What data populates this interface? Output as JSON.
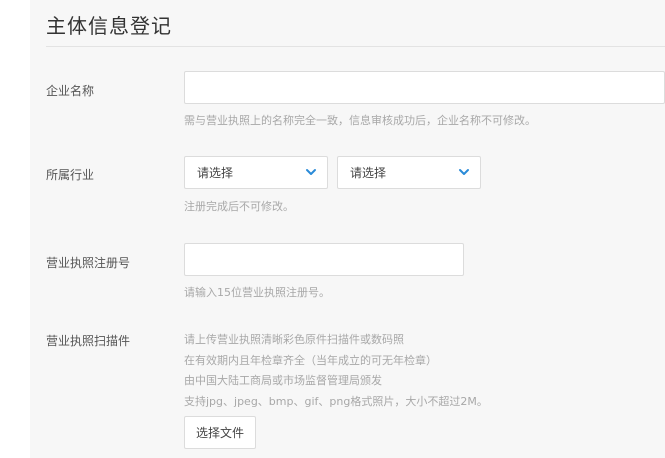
{
  "page": {
    "title": "主体信息登记"
  },
  "company_name": {
    "label": "企业名称",
    "value": "",
    "hint": "需与营业执照上的名称完全一致，信息审核成功后，企业名称不可修改。"
  },
  "industry": {
    "label": "所属行业",
    "select1": "请选择",
    "select2": "请选择",
    "hint": "注册完成后不可修改。",
    "chevron_icon": "chevron-down-icon"
  },
  "license_number": {
    "label": "营业执照注册号",
    "value": "",
    "hint": "请输入15位营业执照注册号。"
  },
  "license_scan": {
    "label": "营业执照扫描件",
    "lines": [
      "请上传营业执照清晰彩色原件扫描件或数码照",
      "在有效期内且年检章齐全（当年成立的可无年检章）",
      "由中国大陆工商局或市场监督管理局颁发",
      "支持jpg、jpeg、bmp、gif、png格式照片，大小不超过2M。"
    ],
    "button": "选择文件"
  },
  "colors": {
    "accent": "#2a8bd8",
    "hint": "#a8a8a8",
    "background": "#f7f7f7"
  }
}
